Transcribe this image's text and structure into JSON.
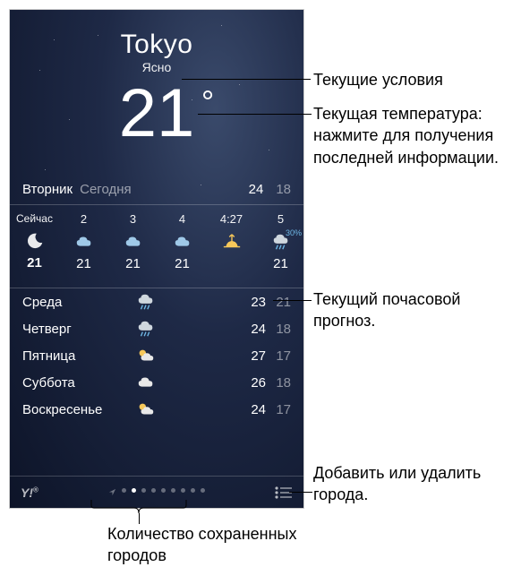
{
  "header": {
    "city": "Tokyo",
    "condition": "Ясно",
    "temperature": "21"
  },
  "today": {
    "day": "Вторник",
    "label": "Сегодня",
    "hi": "24",
    "lo": "18"
  },
  "hourly": [
    {
      "time": "Сейчас",
      "icon": "moon",
      "temp": "21",
      "now": true
    },
    {
      "time": "2",
      "icon": "cloud",
      "temp": "21"
    },
    {
      "time": "3",
      "icon": "cloud",
      "temp": "21"
    },
    {
      "time": "4",
      "icon": "cloud",
      "temp": "21"
    },
    {
      "time": "4:27",
      "icon": "sunrise",
      "temp": ""
    },
    {
      "time": "5",
      "icon": "rain",
      "temp": "21",
      "precip": "30%"
    },
    {
      "time": "",
      "icon": "rain",
      "temp": "",
      "precip": "30"
    }
  ],
  "daily": [
    {
      "name": "Среда",
      "icon": "rain",
      "hi": "23",
      "lo": "21"
    },
    {
      "name": "Четверг",
      "icon": "rain",
      "hi": "24",
      "lo": "18"
    },
    {
      "name": "Пятница",
      "icon": "partly-cloudy",
      "hi": "27",
      "lo": "17"
    },
    {
      "name": "Суббота",
      "icon": "cloudy",
      "hi": "26",
      "lo": "18"
    },
    {
      "name": "Воскресенье",
      "icon": "partly-cloudy",
      "hi": "24",
      "lo": "17"
    }
  ],
  "footer": {
    "yahoo": "Y!",
    "pager_count": 9,
    "active_index": 1
  },
  "callouts": {
    "conditions": "Текущие условия",
    "temperature": "Текущая температура: нажмите для получения последней информации.",
    "hourly": "Текущий почасовой прогноз.",
    "cities": "Добавить или удалить города.",
    "saved": "Количество сохраненных городов"
  }
}
